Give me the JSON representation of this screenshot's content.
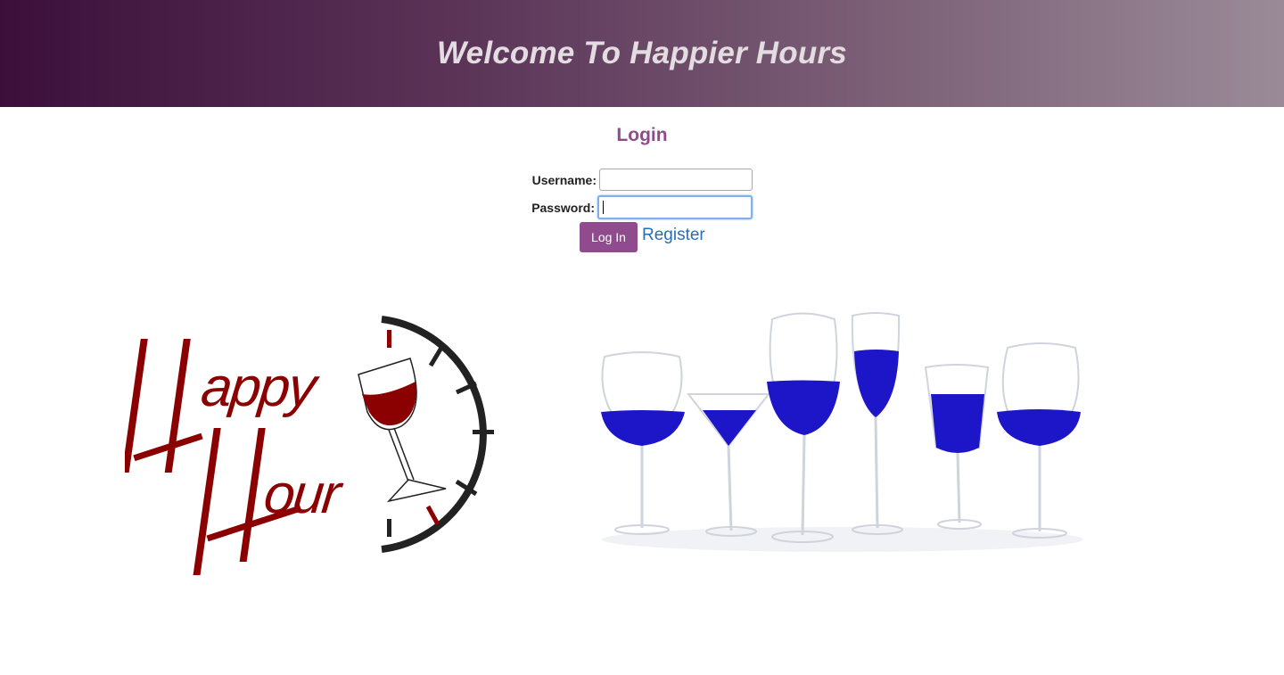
{
  "header": {
    "title": "Welcome To Happier Hours"
  },
  "login": {
    "title": "Login",
    "username_label": "Username:",
    "username_value": "",
    "password_label": "Password:",
    "password_value": "",
    "login_button": "Log In",
    "register_link": "Register"
  },
  "images": {
    "logo_text_line1": "Happy",
    "logo_text_line2": "Hour",
    "logo_color": "#8b0000",
    "glasses_liquid_color": "#1d16c9"
  },
  "colors": {
    "accent": "#8f4b8d",
    "link": "#2a6db5",
    "header_gradient_start": "#3b0f3a",
    "header_gradient_end": "#9a8a98"
  }
}
